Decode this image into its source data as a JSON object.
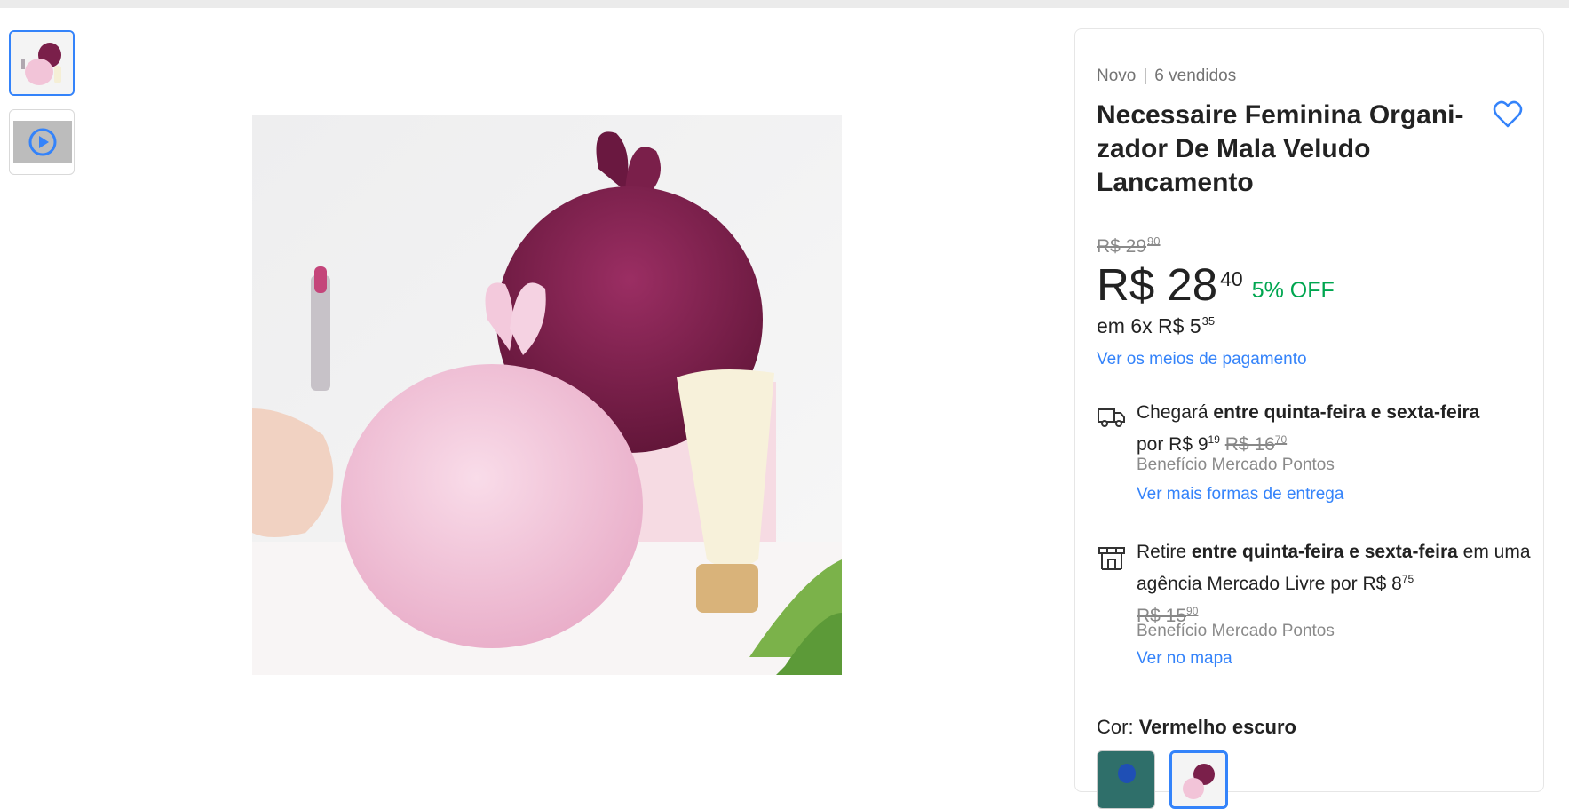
{
  "gallery": {
    "thumbnails": [
      {
        "label": "product-photo",
        "selected": true
      },
      {
        "label": "product-video",
        "selected": false
      }
    ]
  },
  "product": {
    "condition": "Novo",
    "sold": "6 vendidos",
    "title": "Necessaire Feminina Organi-zador De Mala Veludo Lancamento",
    "old_price_int": "R$ 29",
    "old_price_cents": "90",
    "price_int": "R$ 28",
    "price_cents": "40",
    "discount": "5% OFF",
    "installments_prefix": "em 6x R$ 5",
    "installments_cents": "35",
    "payment_link": "Ver os meios de pagamento"
  },
  "shipping": {
    "prefix": "Chegará",
    "range": "entre quinta-feira e sexta-feira",
    "por": "por R$ 9",
    "price_cents": "19",
    "old_price": "R$ 16",
    "old_cents": "70",
    "benefit": "Benefício Mercado Pontos",
    "link": "Ver mais formas de entrega"
  },
  "pickup": {
    "prefix": "Retire",
    "range": "entre quinta-feira e sexta-feira",
    "mid": "em uma agência Mercado Livre por R$ 8",
    "price_cents": "75",
    "old_price": "R$ 15",
    "old_cents": "90",
    "benefit": "Benefício Mercado Pontos",
    "link": "Ver no mapa"
  },
  "color": {
    "label": "Cor:",
    "value": "Vermelho escuro"
  },
  "colors": {
    "accent": "#3483fa",
    "discount": "#00a650",
    "pink_pouch": "#f2c4d8",
    "burgundy_pouch": "#7a1f4a"
  },
  "icons": [
    "heart-icon",
    "truck-icon",
    "store-icon",
    "play-icon"
  ]
}
